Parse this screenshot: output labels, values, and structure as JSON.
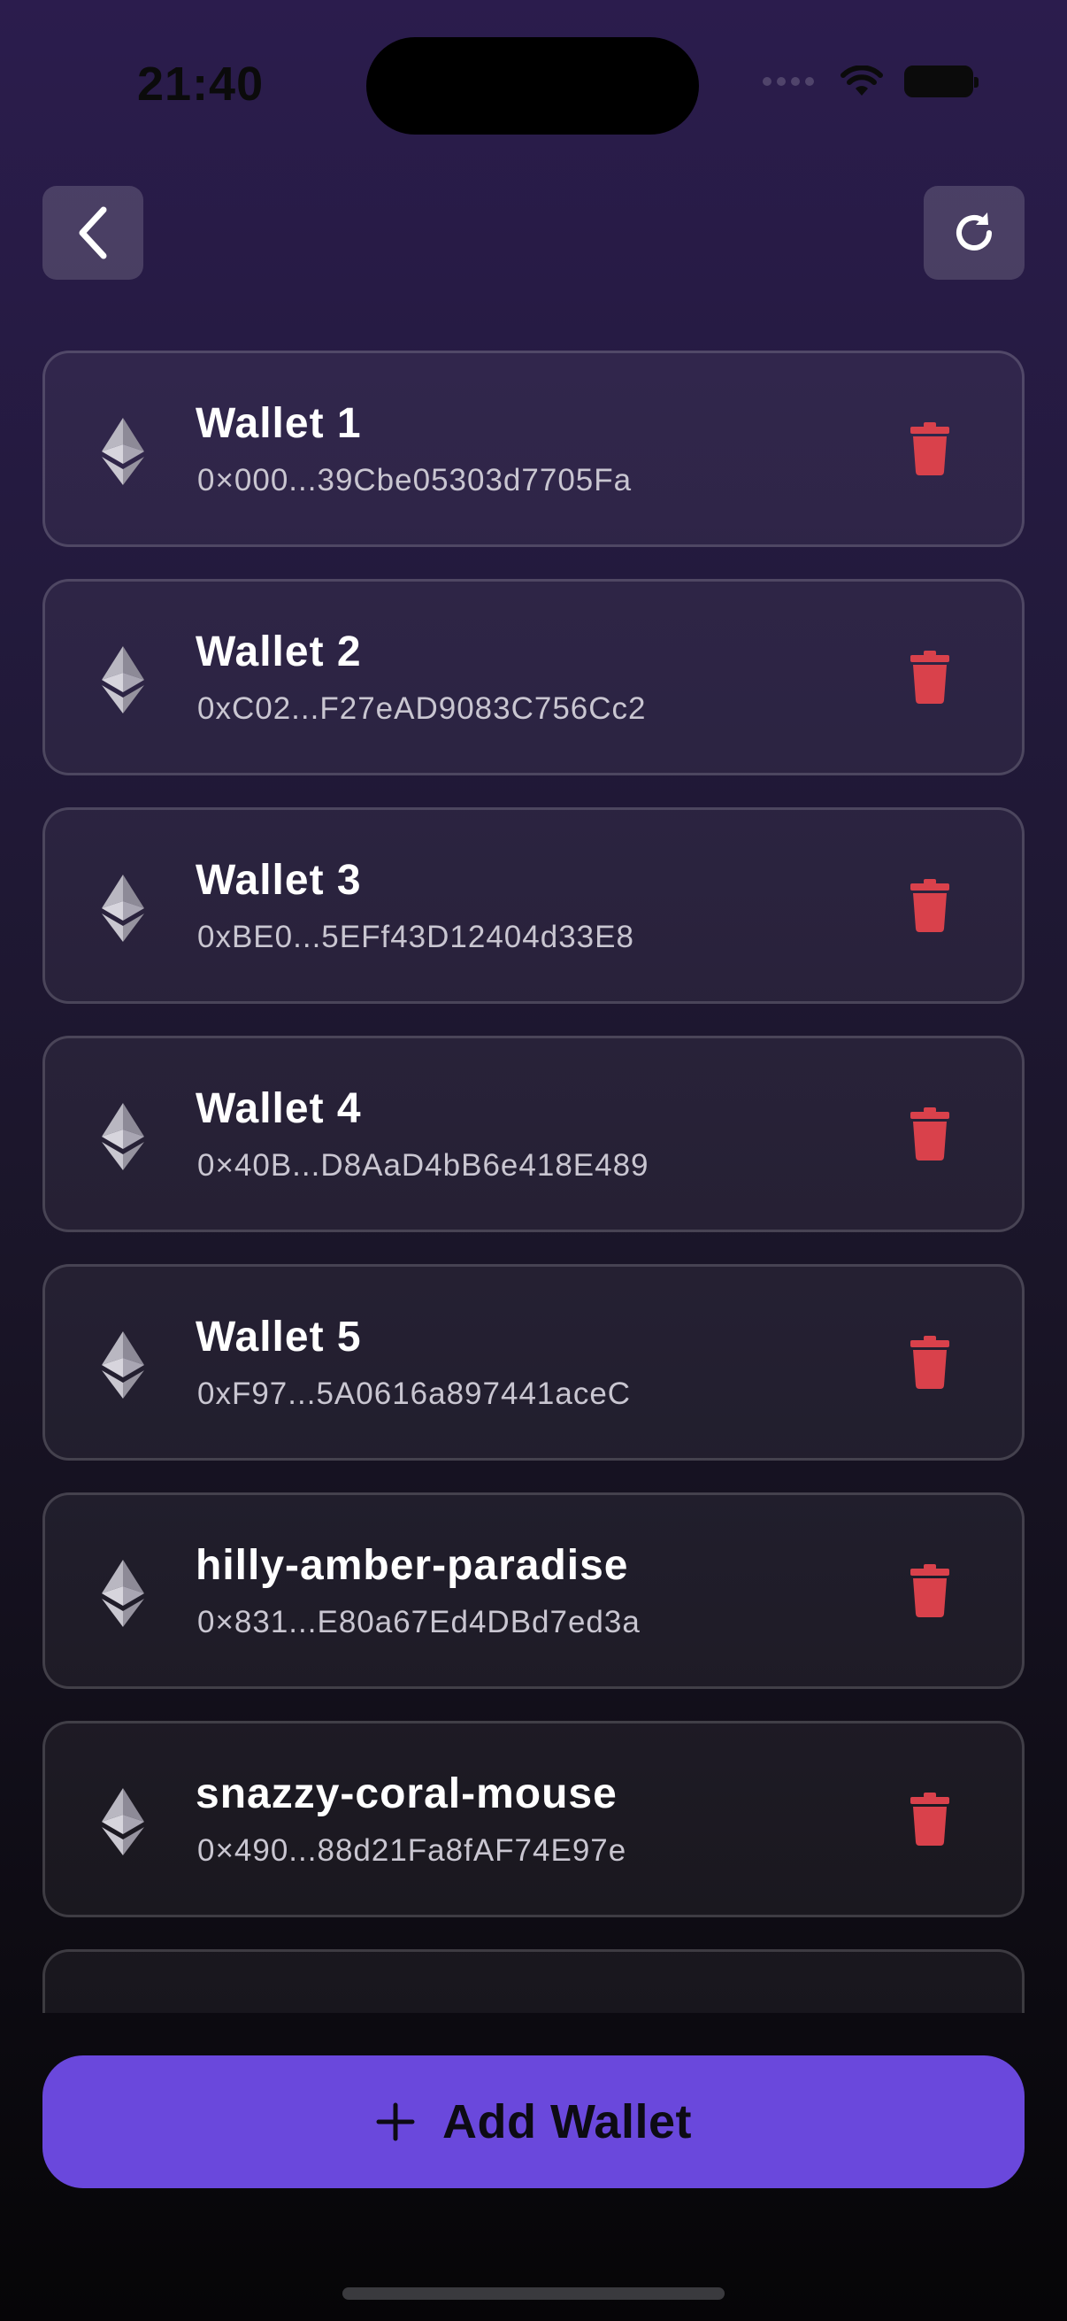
{
  "status_bar": {
    "time": "21:40"
  },
  "header": {
    "back_icon": "chevron-left-icon",
    "refresh_icon": "refresh-icon"
  },
  "wallets": [
    {
      "name": "Wallet 1",
      "address": "0×000...39Cbe05303d7705Fa"
    },
    {
      "name": "Wallet 2",
      "address": "0xC02...F27eAD9083C756Cc2"
    },
    {
      "name": "Wallet 3",
      "address": "0xBE0...5EFf43D12404d33E8"
    },
    {
      "name": "Wallet 4",
      "address": "0×40B...D8AaD4bB6e418E489"
    },
    {
      "name": "Wallet 5",
      "address": "0xF97...5A0616a897441aceC"
    },
    {
      "name": "hilly-amber-paradise",
      "address": "0×831...E80a67Ed4DBd7ed3a"
    },
    {
      "name": "snazzy-coral-mouse",
      "address": "0×490...88d21Fa8fAF74E97e"
    }
  ],
  "add_button": {
    "label": "Add Wallet"
  },
  "colors": {
    "accent": "#6a48dc",
    "delete": "#d9414b",
    "background_top": "#2b1c4d",
    "background_bottom": "#060507"
  }
}
